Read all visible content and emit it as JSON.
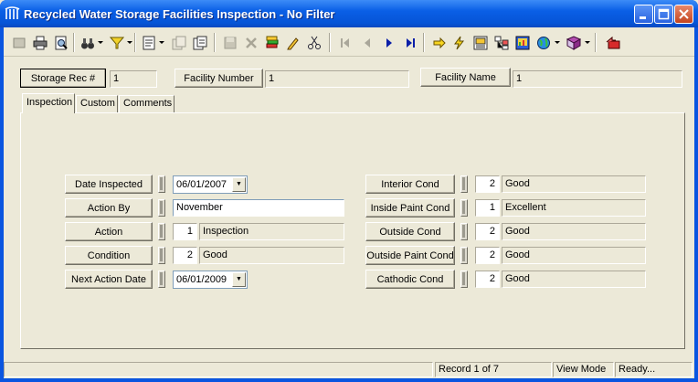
{
  "window": {
    "title": "Recycled Water Storage Facilities Inspection - No Filter"
  },
  "toolbar": {
    "icons": [
      "new-record-icon",
      "print-icon",
      "print-preview-icon",
      "binoculars-icon",
      "filter-icon",
      "form-icon",
      "copy-record-icon",
      "paste-record-icon",
      "save-icon",
      "delete-icon",
      "stack-icon",
      "pencil-icon",
      "scissors-icon",
      "first-record-icon",
      "previous-record-icon",
      "next-record-icon",
      "last-record-icon",
      "arrow-right-icon",
      "lightning-icon",
      "grid-icon",
      "tree-icon",
      "chart-icon",
      "globe-icon",
      "book-icon",
      "exit-icon"
    ]
  },
  "header": {
    "storage_rec_label": "Storage Rec #",
    "storage_rec_value": "1",
    "facility_number_label": "Facility Number",
    "facility_number_value": "1",
    "facility_name_label": "Facility Name",
    "facility_name_value": "1"
  },
  "tabs": [
    "Inspection",
    "Custom",
    "Comments"
  ],
  "left_fields": {
    "date_inspected_label": "Date Inspected",
    "date_inspected_value": "06/01/2007",
    "action_by_label": "Action By",
    "action_by_value": "November",
    "action_label": "Action",
    "action_code": "1",
    "action_value": "Inspection",
    "condition_label": "Condition",
    "condition_code": "2",
    "condition_value": "Good",
    "next_action_date_label": "Next Action Date",
    "next_action_date_value": "06/01/2009"
  },
  "right_fields": {
    "interior_cond_label": "Interior Cond",
    "interior_cond_code": "2",
    "interior_cond_value": "Good",
    "inside_paint_cond_label": "Inside Paint Cond",
    "inside_paint_cond_code": "1",
    "inside_paint_cond_value": "Excellent",
    "outside_cond_label": "Outside Cond",
    "outside_cond_code": "2",
    "outside_cond_value": "Good",
    "outside_paint_cond_label": "Outside Paint Cond",
    "outside_paint_cond_code": "2",
    "outside_paint_cond_value": "Good",
    "cathodic_cond_label": "Cathodic Cond",
    "cathodic_cond_code": "2",
    "cathodic_cond_value": "Good"
  },
  "status": {
    "record": "Record 1 of 7",
    "mode": "View Mode",
    "state": "Ready..."
  },
  "colors": {
    "titlebar": "#0a5fe6",
    "face": "#ece9d8",
    "close_button": "#c4441e"
  }
}
